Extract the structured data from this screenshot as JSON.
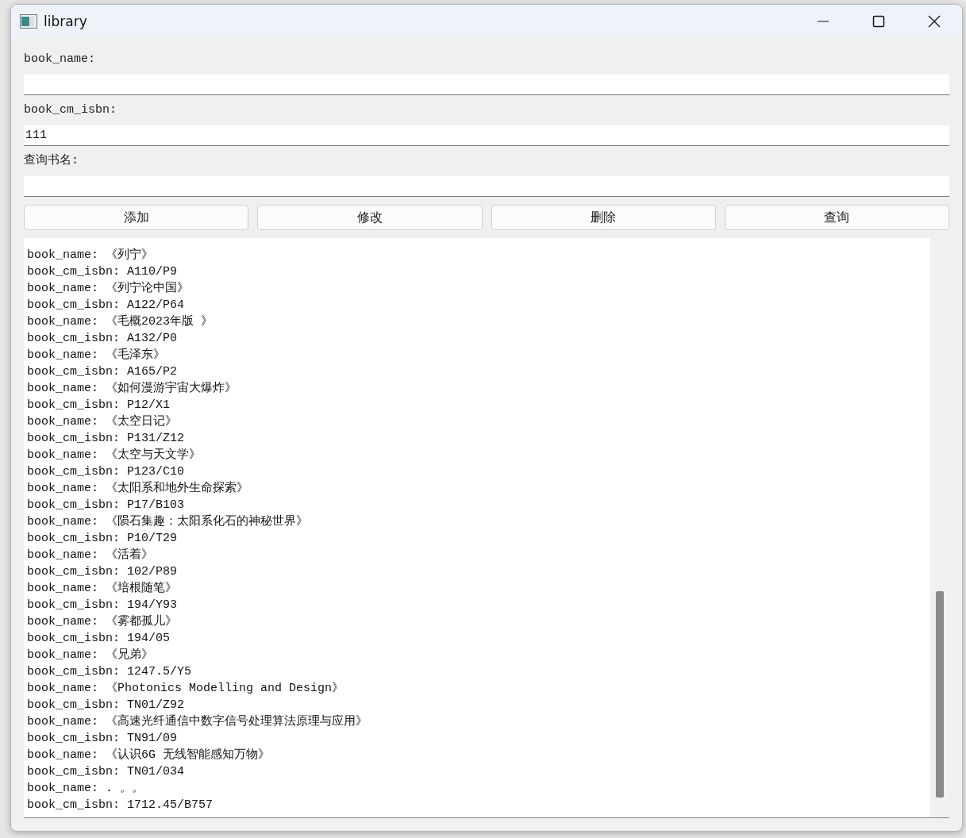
{
  "window": {
    "title": "library"
  },
  "fields": [
    {
      "label": "book_name:"
    },
    {
      "label": "book_cm_isbn:",
      "value": "111"
    },
    {
      "label": "查询书名:"
    }
  ],
  "buttons": [
    "添加",
    "修改",
    "删除",
    "查询"
  ],
  "output_lines": [
    "book_name: 《列宁》",
    "book_cm_isbn: A110/P9",
    "book_name: 《列宁论中国》",
    "book_cm_isbn: A122/P64",
    "book_name: 《毛概2023年版 》",
    "book_cm_isbn: A132/P0",
    "book_name: 《毛泽东》",
    "book_cm_isbn: A165/P2",
    "book_name: 《如何漫游宇宙大爆炸》",
    "book_cm_isbn: P12/X1",
    "book_name: 《太空日记》",
    "book_cm_isbn: P131/Z12",
    "book_name: 《太空与天文学》",
    "book_cm_isbn: P123/C10",
    "book_name: 《太阳系和地外生命探索》",
    "book_cm_isbn: P17/B103",
    "book_name: 《陨石集趣：太阳系化石的神秘世界》",
    "book_cm_isbn: P10/T29",
    "book_name: 《活着》",
    "book_cm_isbn: 102/P89",
    "book_name: 《培根随笔》",
    "book_cm_isbn: 194/Y93",
    "book_name: 《雾都孤儿》",
    "book_cm_isbn: 194/05",
    "book_name: 《兄弟》",
    "book_cm_isbn: 1247.5/Y5",
    "book_name: 《Photonics Modelling and Design》",
    "book_cm_isbn: TN01/Z92",
    "book_name: 《高速光纤通信中数字信号处理算法原理与应用》",
    "book_cm_isbn: TN91/09",
    "book_name: 《认识6G 无线智能感知万物》",
    "book_cm_isbn: TN01/034",
    "book_name: . 。。",
    "book_cm_isbn: 1712.45/B757"
  ]
}
